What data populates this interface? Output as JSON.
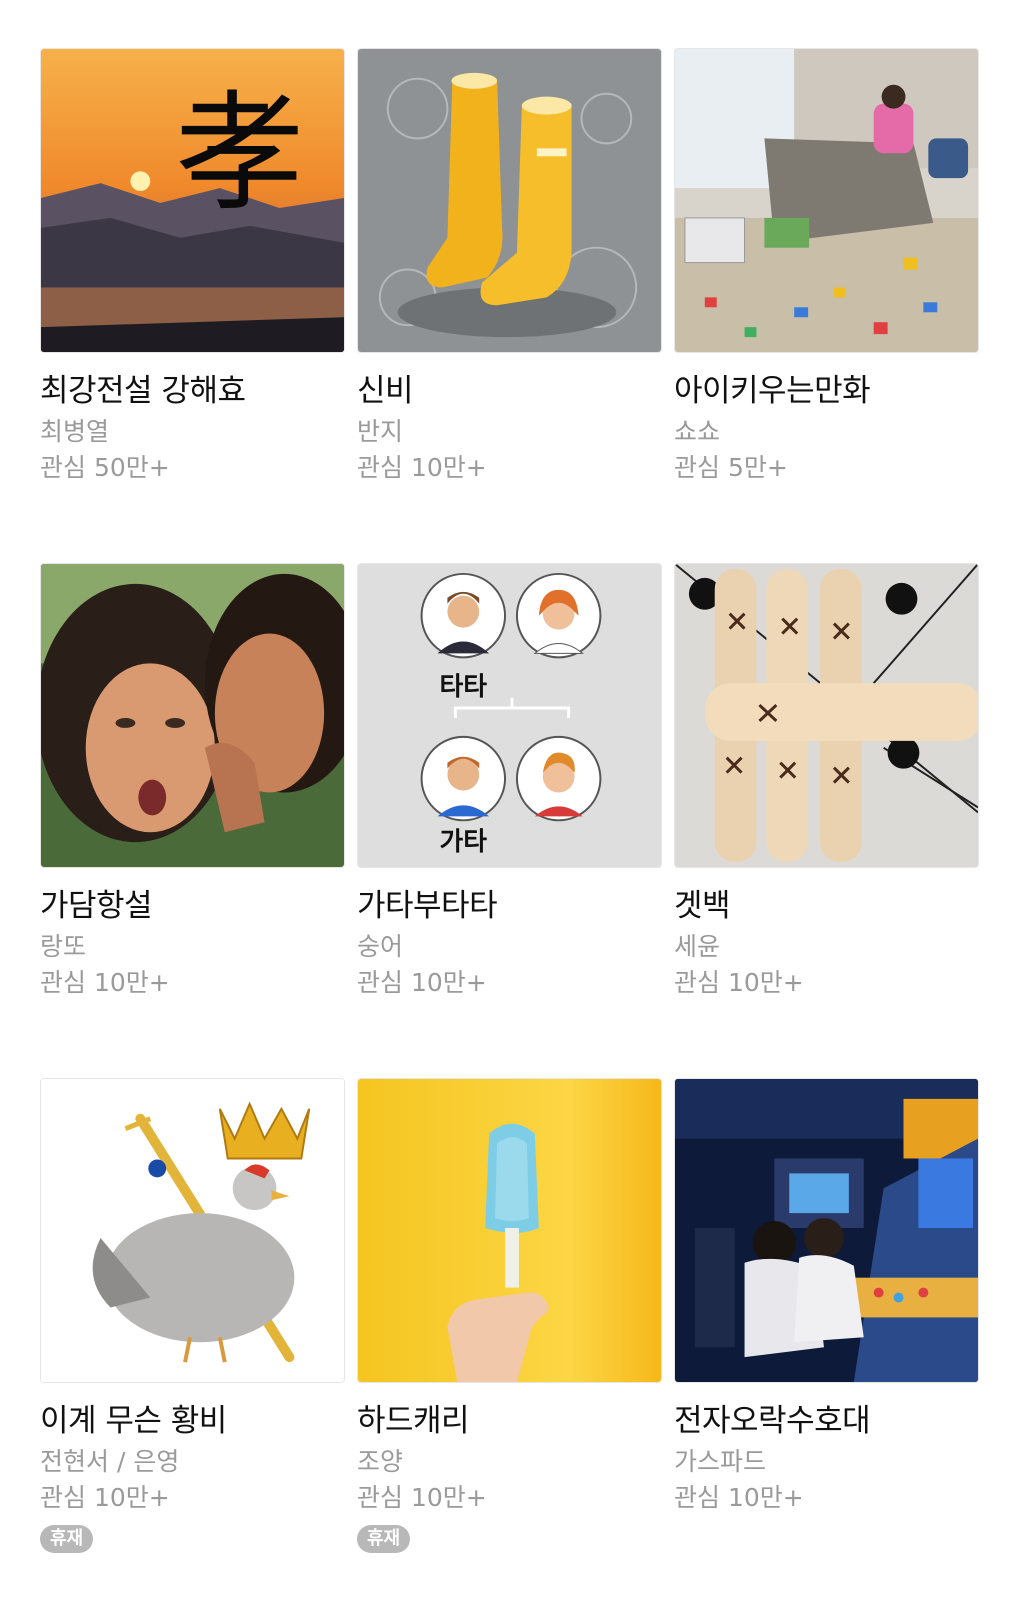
{
  "items": [
    {
      "title": "최강전설 강해효",
      "author": "최병열",
      "interest": "관심 50만+",
      "badge": "",
      "thumb_icon": "sunset-mountain-hanja-icon"
    },
    {
      "title": "신비",
      "author": "반지",
      "interest": "관심 10만+",
      "badge": "",
      "thumb_icon": "yellow-rain-boots-icon"
    },
    {
      "title": "아이키우는만화",
      "author": "쇼쇼",
      "interest": "관심 5만+",
      "badge": "",
      "thumb_icon": "messy-living-room-icon"
    },
    {
      "title": "가담항설",
      "author": "랑또",
      "interest": "관심 10만+",
      "badge": "",
      "thumb_icon": "whispering-women-icon"
    },
    {
      "title": "가타부타타",
      "author": "숭어",
      "interest": "관심 10만+",
      "badge": "",
      "thumb_icon": "family-tree-icon",
      "thumb_text": [
        "타타",
        "가타"
      ]
    },
    {
      "title": "겟백",
      "author": "세윤",
      "interest": "관심 10만+",
      "badge": "",
      "thumb_icon": "wooden-yut-sticks-icon"
    },
    {
      "title": "이계 무슨 황비",
      "author": "전현서 / 은영",
      "interest": "관심 10만+",
      "badge": "휴재",
      "thumb_icon": "crowned-chicken-icon"
    },
    {
      "title": "하드캐리",
      "author": "조양",
      "interest": "관심 10만+",
      "badge": "휴재",
      "thumb_icon": "blue-popsicle-icon"
    },
    {
      "title": "전자오락수호대",
      "author": "가스파드",
      "interest": "관심 10만+",
      "badge": "",
      "thumb_icon": "arcade-room-icon"
    }
  ],
  "thumb_hanja": "孝",
  "colors": {
    "title": "#111111",
    "meta": "#9a9a9a",
    "badge_bg": "#b8b8b8"
  }
}
